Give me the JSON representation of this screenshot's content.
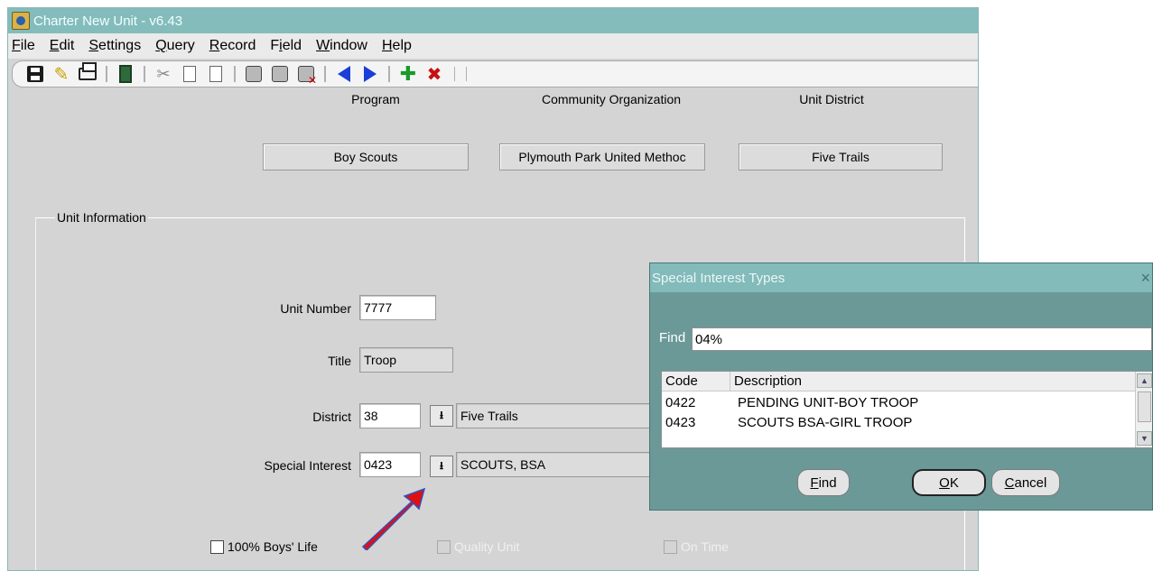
{
  "window": {
    "title": "Charter New Unit - v6.43"
  },
  "menu": [
    {
      "label": "File",
      "mnemonic": "F",
      "rest": "ile"
    },
    {
      "label": "Edit",
      "mnemonic": "E",
      "rest": "dit"
    },
    {
      "label": "Settings",
      "mnemonic": "S",
      "rest": "ettings"
    },
    {
      "label": "Query",
      "mnemonic": "Q",
      "rest": "uery"
    },
    {
      "label": "Record",
      "mnemonic": "R",
      "rest": "ecord"
    },
    {
      "label": "Field",
      "mnemonic": "i",
      "pre": "F",
      "rest": "eld"
    },
    {
      "label": "Window",
      "mnemonic": "W",
      "rest": "indow"
    },
    {
      "label": "Help",
      "mnemonic": "H",
      "rest": "elp"
    }
  ],
  "toolbar_icons": [
    "save-icon",
    "edit-pencil-icon",
    "print-icon",
    "exit-door-icon",
    "cut-icon",
    "copy-icon",
    "paste-icon",
    "enter-query-icon",
    "execute-query-icon",
    "cancel-query-icon",
    "previous-record-icon",
    "next-record-icon",
    "insert-record-icon",
    "delete-record-icon"
  ],
  "header": {
    "program_label": "Program",
    "program_value": "Boy Scouts",
    "org_label": "Community Organization",
    "org_value": "Plymouth Park United Methoc",
    "district_label": "Unit District",
    "district_value": "Five Trails"
  },
  "unit_info": {
    "group_title": "Unit Information",
    "unit_number_label": "Unit Number",
    "unit_number": "7777",
    "title_label": "Title",
    "title_value": "Troop",
    "district_label": "District",
    "district_code": "38",
    "district_name": "Five Trails",
    "special_interest_label": "Special Interest",
    "special_interest_code": "0423",
    "special_interest_name": "SCOUTS, BSA",
    "lov_glyph": "⭳",
    "checkbox_boys_life": "100% Boys' Life",
    "checkbox_quality_unit": "Quality Unit",
    "checkbox_on_time": "On Time"
  },
  "dialog": {
    "title": "Special Interest Types",
    "close_glyph": "×",
    "find_label": "Find",
    "find_value": "04%",
    "columns": [
      "Code",
      "Description"
    ],
    "rows": [
      {
        "code": "0422",
        "description": "PENDING UNIT-BOY TROOP"
      },
      {
        "code": "0423",
        "description": "SCOUTS BSA-GIRL TROOP"
      }
    ],
    "find_button": {
      "mnemonic": "F",
      "rest": "ind"
    },
    "ok_button": {
      "mnemonic": "O",
      "rest": "K"
    },
    "cancel_button": {
      "mnemonic": "C",
      "rest": "ancel"
    }
  },
  "colors": {
    "titlebar": "#84bcbc",
    "dialog_body": "#6b9998",
    "annotation_arrow": "#e01010"
  }
}
